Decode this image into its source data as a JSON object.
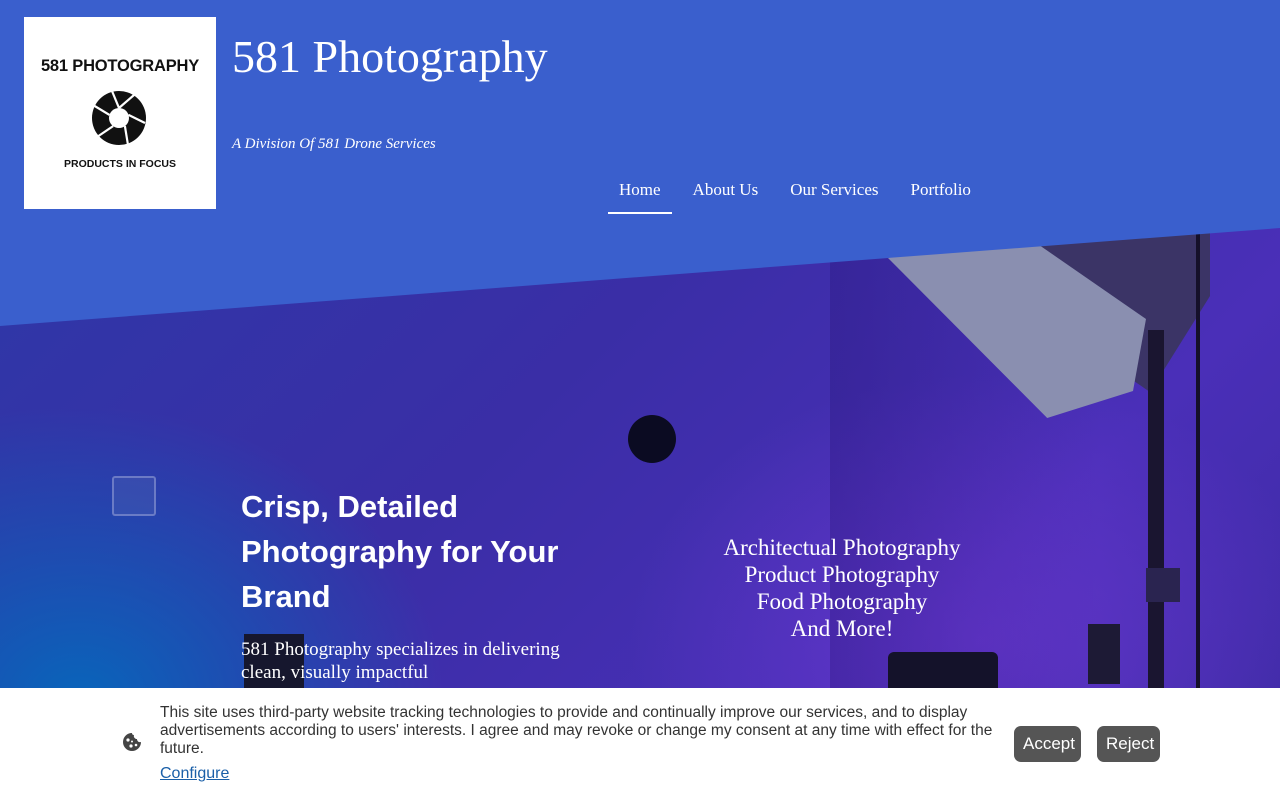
{
  "brand": {
    "logo_title": "581 PHOTOGRAPHY",
    "logo_subtitle": "PRODUCTS IN FOCUS",
    "site_title": "581 Photography",
    "tagline": "A Division Of 581 Drone Services",
    "color": "#3a5fcd"
  },
  "nav": {
    "items": [
      {
        "label": "Home",
        "active": true
      },
      {
        "label": "About Us",
        "active": false
      },
      {
        "label": "Our Services",
        "active": false
      },
      {
        "label": "Portfolio",
        "active": false
      }
    ]
  },
  "hero": {
    "heading": "Crisp, Detailed Photography for Your Brand",
    "body": "581 Photography specializes in delivering clean, visually impactful",
    "services": [
      "Architectual Photography",
      "Product Photography",
      "Food Photography",
      "And More!"
    ]
  },
  "cookie": {
    "text": "This site uses third-party website tracking technologies to provide and continually improve our services, and to display advertisements according to users' interests. I agree and may revoke or change my consent at any time with effect for the future.",
    "configure_label": "Configure",
    "accept_label": "Accept",
    "reject_label": "Reject",
    "icon": "cookie-icon"
  }
}
